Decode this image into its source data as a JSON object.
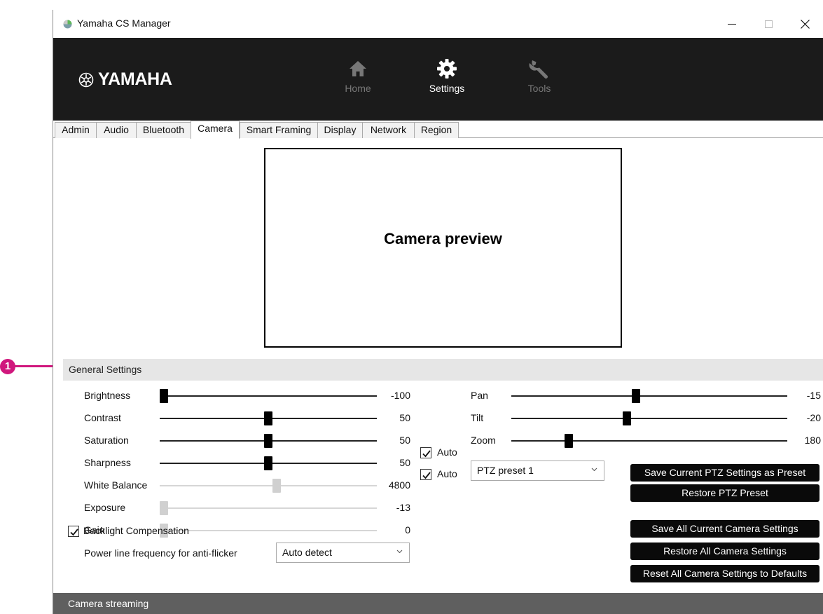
{
  "window": {
    "title": "Yamaha CS Manager",
    "controls": {
      "minimize": "minimize",
      "maximize": "maximize",
      "close": "close"
    }
  },
  "header": {
    "logo_text": "YAMAHA",
    "nav": [
      {
        "label": "Home",
        "icon": "home-icon",
        "state": "inactive"
      },
      {
        "label": "Settings",
        "icon": "gear-icon",
        "state": "active"
      },
      {
        "label": "Tools",
        "icon": "wrench-icon",
        "state": "inactive"
      }
    ]
  },
  "tabs": [
    "Admin",
    "Audio",
    "Bluetooth",
    "Camera",
    "Smart Framing",
    "Display",
    "Network",
    "Region"
  ],
  "active_tab": "Camera",
  "preview": {
    "label": "Camera preview"
  },
  "general": {
    "title": "General Settings",
    "left_sliders": [
      {
        "label": "Brightness",
        "value": "-100",
        "min": -100,
        "max": 100,
        "disabled": false
      },
      {
        "label": "Contrast",
        "value": "50",
        "min": 0,
        "max": 100,
        "disabled": false
      },
      {
        "label": "Saturation",
        "value": "50",
        "min": 0,
        "max": 100,
        "disabled": false
      },
      {
        "label": "Sharpness",
        "value": "50",
        "min": 0,
        "max": 100,
        "disabled": false
      },
      {
        "label": "White Balance",
        "value": "4800",
        "min": 2800,
        "max": 6500,
        "disabled": true,
        "auto_label": "Auto",
        "auto_checked": true
      },
      {
        "label": "Exposure",
        "value": "-13",
        "min": -13,
        "max": 0,
        "disabled": true,
        "auto_label": "Auto",
        "auto_checked": true
      },
      {
        "label": "Gain",
        "value": "0",
        "min": 0,
        "max": 100,
        "disabled": true
      }
    ],
    "backlight": {
      "label": "Backlight Compensation",
      "checked": true
    },
    "power_line": {
      "label": "Power line frequency for anti-flicker",
      "selected": "Auto detect"
    },
    "ptz_sliders": [
      {
        "label": "Pan",
        "value": "-15",
        "min": -150,
        "max": 150
      },
      {
        "label": "Tilt",
        "value": "-20",
        "min": -120,
        "max": 120
      },
      {
        "label": "Zoom",
        "value": "180",
        "min": 100,
        "max": 500
      }
    ],
    "ptz_preset": {
      "selected": "PTZ preset 1"
    },
    "buttons": {
      "save_ptz": "Save Current PTZ Settings as Preset",
      "restore_ptz": "Restore PTZ Preset",
      "save_all": "Save All Current Camera Settings",
      "restore_all": "Restore All Camera Settings",
      "reset_all": "Reset All Camera Settings to Defaults"
    }
  },
  "streaming": {
    "title": "Camera streaming"
  },
  "callout": {
    "number": "1",
    "color": "#d0177d"
  },
  "colors": {
    "header_bg": "#1b1b1b",
    "section_bg": "#e6e6e6",
    "button_bg": "#0a0a0a",
    "streaming_bg": "#5f5f5f"
  }
}
